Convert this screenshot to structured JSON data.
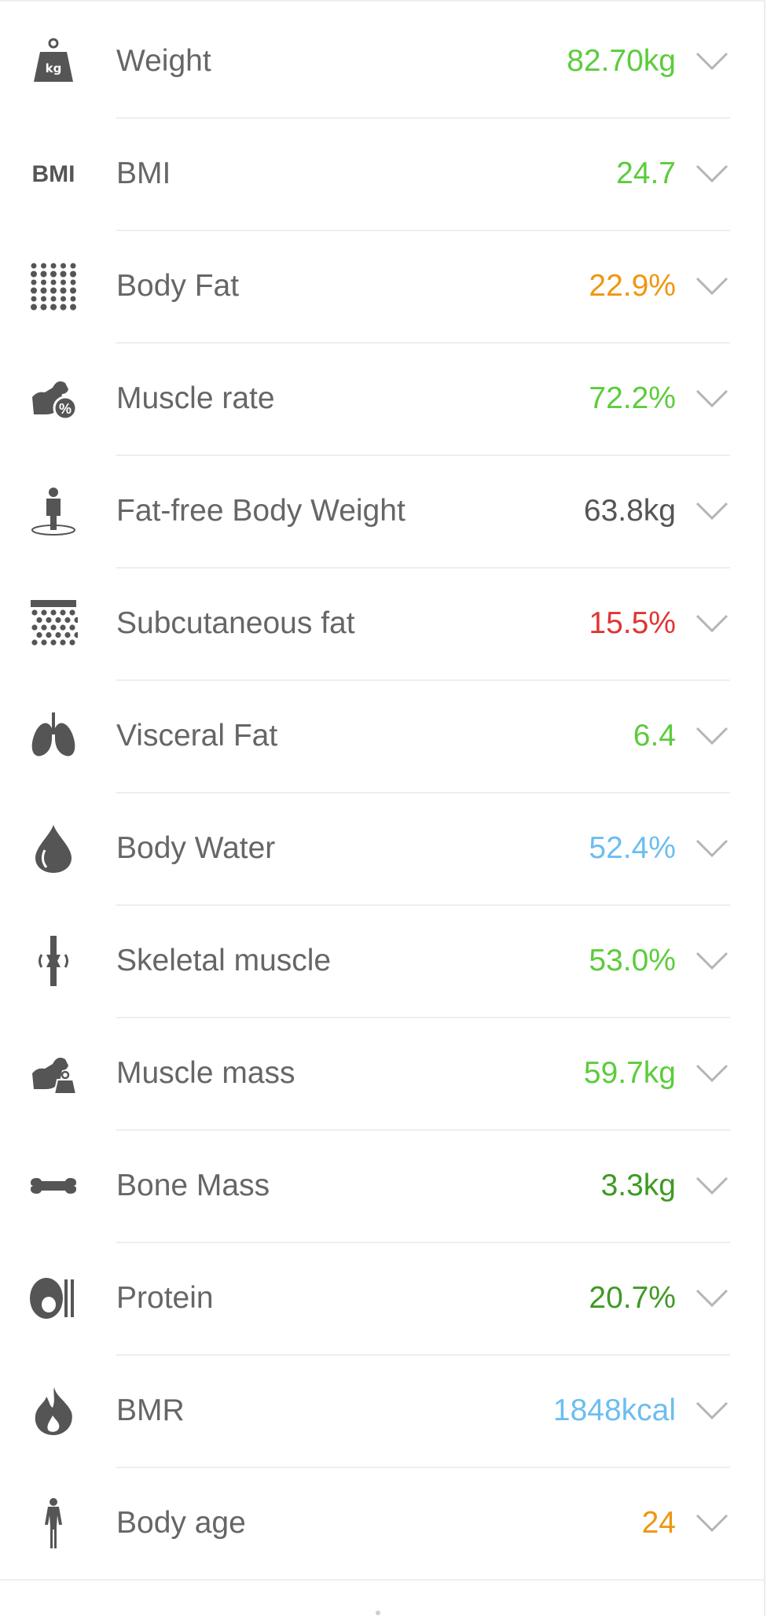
{
  "metrics": [
    {
      "label": "Weight",
      "value": "82.70kg",
      "color": "#5ccc3b",
      "icon": "weight-kg-icon"
    },
    {
      "label": "BMI",
      "value": "24.7",
      "color": "#5ccc3b",
      "icon": "bmi-icon",
      "icon_text": "BMI"
    },
    {
      "label": "Body Fat",
      "value": "22.9%",
      "color": "#f0960f",
      "icon": "body-fat-dots-icon"
    },
    {
      "label": "Muscle rate",
      "value": "72.2%",
      "color": "#5ccc3b",
      "icon": "muscle-percent-icon",
      "icon_text": "%"
    },
    {
      "label": "Fat-free Body Weight",
      "value": "63.8kg",
      "color": "#555555",
      "icon": "fat-free-body-icon"
    },
    {
      "label": "Subcutaneous fat",
      "value": "15.5%",
      "color": "#e03535",
      "icon": "subcutaneous-fat-icon"
    },
    {
      "label": "Visceral Fat",
      "value": "6.4",
      "color": "#5ccc3b",
      "icon": "lungs-icon"
    },
    {
      "label": "Body Water",
      "value": "52.4%",
      "color": "#6bbef0",
      "icon": "water-drop-icon"
    },
    {
      "label": "Skeletal muscle",
      "value": "53.0%",
      "color": "#5ccc3b",
      "icon": "skeletal-joint-icon"
    },
    {
      "label": "Muscle mass",
      "value": "59.7kg",
      "color": "#5ccc3b",
      "icon": "muscle-weight-icon"
    },
    {
      "label": "Bone Mass",
      "value": "3.3kg",
      "color": "#3f9a24",
      "icon": "bone-icon"
    },
    {
      "label": "Protein",
      "value": "20.7%",
      "color": "#3f9a24",
      "icon": "protein-icon"
    },
    {
      "label": "BMR",
      "value": "1848kcal",
      "color": "#6bbef0",
      "icon": "flame-icon"
    },
    {
      "label": "Body age",
      "value": "24",
      "color": "#f0960f",
      "icon": "person-icon"
    }
  ],
  "icon_color": "#555555",
  "chevron_color": "#b5b5b5"
}
